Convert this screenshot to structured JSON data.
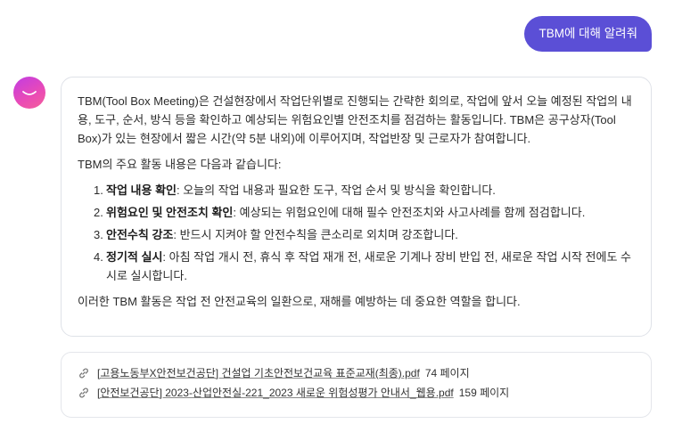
{
  "user_message": "TBM에 대해 알려줘",
  "answer": {
    "intro": "TBM(Tool Box Meeting)은 건설현장에서 작업단위별로 진행되는 간략한 회의로, 작업에 앞서 오늘 예정된 작업의 내용, 도구, 순서, 방식 등을 확인하고 예상되는 위험요인별 안전조치를 점검하는 활동입니다. TBM은 공구상자(Tool Box)가 있는 현장에서 짧은 시간(약 5분 내외)에 이루어지며, 작업반장 및 근로자가 참여합니다.",
    "list_lead": "TBM의 주요 활동 내용은 다음과 같습니다:",
    "items": [
      {
        "num": "1.",
        "title": "작업 내용 확인",
        "text": ": 오늘의 작업 내용과 필요한 도구, 작업 순서 및 방식을 확인합니다."
      },
      {
        "num": "2.",
        "title": "위험요인 및 안전조치 확인",
        "text": ": 예상되는 위험요인에 대해 필수 안전조치와 사고사례를 함께 점검합니다."
      },
      {
        "num": "3.",
        "title": "안전수칙 강조",
        "text": ": 반드시 지켜야 할 안전수칙을 큰소리로 외치며 강조합니다."
      },
      {
        "num": "4.",
        "title": "정기적 실시",
        "text": ": 아침 작업 개시 전, 휴식 후 작업 재개 전, 새로운 기계나 장비 반입 전, 새로운 작업 시작 전에도 수시로 실시합니다."
      }
    ],
    "conclusion": "이러한 TBM 활동은 작업 전 안전교육의 일환으로, 재해를 예방하는 데 중요한 역할을 합니다."
  },
  "sources": [
    {
      "icon": "link-icon",
      "title": "[고용노동부X안전보건공단] 건설업 기초안전보건교육 표준교재(최종).pdf",
      "pages": "74 페이지"
    },
    {
      "icon": "link-icon",
      "title": "[안전보건공단] 2023-산업안전실-221_2023 새로운 위험성평가 안내서_웹용.pdf",
      "pages": "159 페이지"
    }
  ],
  "colors": {
    "user_bubble": "#5b4fd6",
    "avatar_gradient_start": "#c13ce3",
    "avatar_gradient_end": "#f35f9a"
  }
}
